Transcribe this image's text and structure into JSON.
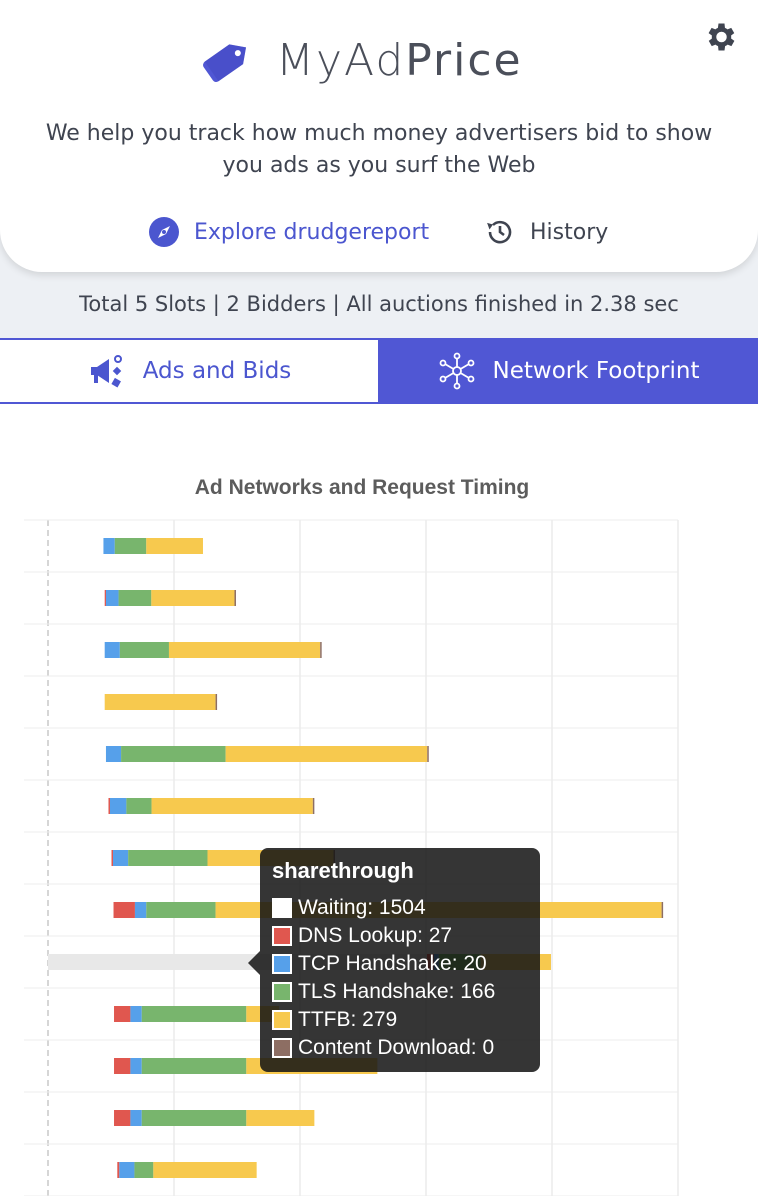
{
  "app": {
    "brand_light": "MyAd",
    "brand_bold": "Price",
    "tagline": "We help you track how much money advertisers bid to show you ads as you surf the Web"
  },
  "nav": {
    "explore": "Explore drudgereport",
    "history": "History"
  },
  "stats": "Total 5 Slots | 2 Bidders | All auctions finished in 2.38 sec",
  "tabs": [
    {
      "label": "Ads and Bids",
      "icon": "megaphone-icon",
      "active": false
    },
    {
      "label": "Network Footprint",
      "icon": "network-icon",
      "active": true
    }
  ],
  "colors": {
    "accent": "#5057d4",
    "waiting": "#e8e8e8",
    "dns": "#e0574f",
    "tcp": "#56a0ea",
    "tls": "#78b56d",
    "ttfb": "#f7c94e",
    "download": "#8d6e63"
  },
  "chart_data": {
    "type": "bar",
    "orientation": "horizontal",
    "stacked": true,
    "title": "Ad Networks and Request Timing",
    "segments": [
      "Waiting",
      "DNS Lookup",
      "TCP Handshake",
      "TLS Handshake",
      "TTFB",
      "Content Download"
    ],
    "units": "ms",
    "xlim": [
      0,
      2500
    ],
    "grid": true,
    "rows": [
      {
        "waiting": 220,
        "dns": 0,
        "tcp": 45,
        "tls": 125,
        "ttfb": 225,
        "download": 0
      },
      {
        "waiting": 225,
        "dns": 5,
        "tcp": 50,
        "tls": 130,
        "ttfb": 330,
        "download": 3
      },
      {
        "waiting": 225,
        "dns": 0,
        "tcp": 60,
        "tls": 195,
        "ttfb": 600,
        "download": 3
      },
      {
        "waiting": 225,
        "dns": 0,
        "tcp": 0,
        "tls": 0,
        "ttfb": 440,
        "download": 5
      },
      {
        "waiting": 230,
        "dns": 0,
        "tcp": 60,
        "tls": 415,
        "ttfb": 800,
        "download": 3
      },
      {
        "waiting": 240,
        "dns": 6,
        "tcp": 65,
        "tls": 100,
        "ttfb": 640,
        "download": 3
      },
      {
        "waiting": 252,
        "dns": 6,
        "tcp": 60,
        "tls": 315,
        "ttfb": 500,
        "download": 3
      },
      {
        "waiting": 260,
        "dns": 85,
        "tcp": 45,
        "tls": 275,
        "ttfb": 1770,
        "download": 3
      },
      {
        "name": "sharethrough",
        "highlighted": true,
        "waiting": 1504,
        "dns": 27,
        "tcp": 20,
        "tls": 166,
        "ttfb": 279,
        "download": 0
      },
      {
        "waiting": 262,
        "dns": 65,
        "tcp": 45,
        "tls": 415,
        "ttfb": 130,
        "download": 0
      },
      {
        "waiting": 262,
        "dns": 65,
        "tcp": 45,
        "tls": 415,
        "ttfb": 520,
        "download": 0
      },
      {
        "waiting": 262,
        "dns": 65,
        "tcp": 45,
        "tls": 415,
        "ttfb": 270,
        "download": 0
      },
      {
        "waiting": 275,
        "dns": 8,
        "tcp": 60,
        "tls": 75,
        "ttfb": 410,
        "download": 0
      }
    ]
  },
  "tooltip": {
    "title": "sharethrough",
    "rows": [
      {
        "label": "Waiting: 1504",
        "color": "#ffffff"
      },
      {
        "label": "DNS Lookup: 27",
        "color": "#e0574f"
      },
      {
        "label": "TCP Handshake: 20",
        "color": "#56a0ea"
      },
      {
        "label": "TLS Handshake: 166",
        "color": "#78b56d"
      },
      {
        "label": "TTFB: 279",
        "color": "#f7c94e"
      },
      {
        "label": "Content Download: 0",
        "color": "#8d6e63"
      }
    ]
  }
}
